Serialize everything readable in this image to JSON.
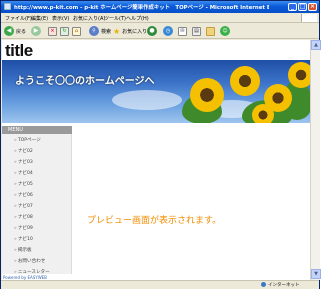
{
  "window": {
    "title": "http://www.p-kit.com - p-kit ホームページ簡単作成キット　TOPページ - Microsoft Internet Explorer"
  },
  "menubar": {
    "items": [
      "ファイル(F)",
      "編集(E)",
      "表示(V)",
      "お気に入り(A)",
      "ツール(T)",
      "ヘルプ(H)"
    ]
  },
  "toolbar": {
    "back_label": "戻る",
    "search_label": "検索",
    "favorites_label": "お気に入り"
  },
  "page": {
    "logo": "title",
    "banner_text": "ようこそ〇〇のホームページへ",
    "nav_header": "MENU",
    "nav_items": [
      "TOPページ",
      "ナビ02",
      "ナビ03",
      "ナビ04",
      "ナビ05",
      "ナビ06",
      "ナビ07",
      "ナビ08",
      "ナビ09",
      "ナビ10",
      "掲示板",
      "お問い合わせ",
      "ニュースレター"
    ],
    "preview_message": "プレビュー画面が表示されます。",
    "print_label": "印刷",
    "powered_by": "Powered by EASYWEB"
  },
  "statusbar": {
    "zone": "インターネット"
  },
  "colors": {
    "accent_orange": "#f08c00",
    "title_blue": "#0a5ad8"
  }
}
